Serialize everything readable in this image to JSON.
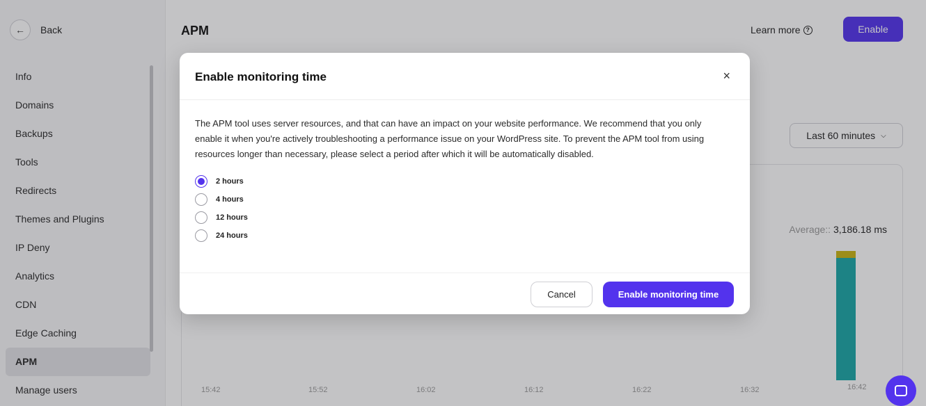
{
  "sidebar": {
    "back_label": "Back",
    "items": [
      {
        "label": "Info"
      },
      {
        "label": "Domains"
      },
      {
        "label": "Backups"
      },
      {
        "label": "Tools"
      },
      {
        "label": "Redirects"
      },
      {
        "label": "Themes and Plugins"
      },
      {
        "label": "IP Deny"
      },
      {
        "label": "Analytics"
      },
      {
        "label": "CDN"
      },
      {
        "label": "Edge Caching"
      },
      {
        "label": "APM",
        "active": true
      },
      {
        "label": "Manage users"
      }
    ]
  },
  "header": {
    "title": "APM",
    "learn_more": "Learn more",
    "enable_label": "Enable"
  },
  "filters": {
    "time_range": "Last 60 minutes"
  },
  "chart": {
    "average_label": "Average::",
    "average_value": "3,186.18 ms",
    "x_ticks": [
      "15:42",
      "15:52",
      "16:02",
      "16:12",
      "16:22",
      "16:32",
      "16:42"
    ]
  },
  "chart_data": {
    "type": "bar",
    "categories": [
      "15:42",
      "15:52",
      "16:02",
      "16:12",
      "16:22",
      "16:32",
      "16:42"
    ],
    "average": 3186.18,
    "unit": "ms"
  },
  "modal": {
    "title": "Enable monitoring time",
    "close": "×",
    "description": "The APM tool uses server resources, and that can have an impact on your website performance. We recommend that you only enable it when you're actively troubleshooting a performance issue on your WordPress site. To prevent the APM tool from using resources longer than necessary, please select a period after which it will be automatically disabled.",
    "options": [
      {
        "label": "2 hours",
        "checked": true
      },
      {
        "label": "4 hours",
        "checked": false
      },
      {
        "label": "12 hours",
        "checked": false
      },
      {
        "label": "24 hours",
        "checked": false
      }
    ],
    "cancel_label": "Cancel",
    "confirm_label": "Enable monitoring time"
  },
  "colors": {
    "accent": "#5333ed",
    "bar_main": "#1aa7a7",
    "bar_warn": "#c9b413"
  }
}
